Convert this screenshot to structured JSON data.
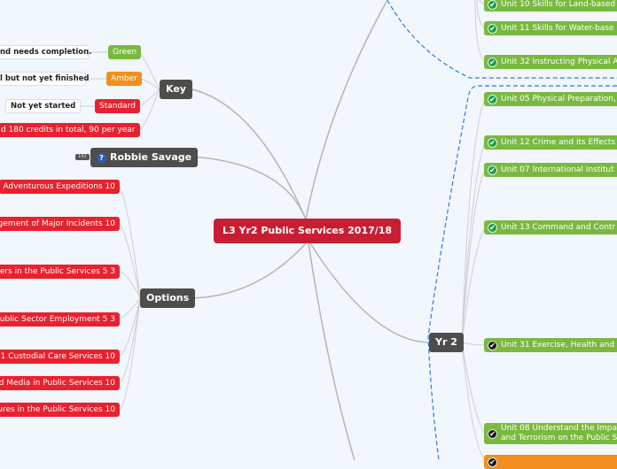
{
  "root": {
    "title": "L3 Yr2 Public Services 2017/18"
  },
  "colors": {
    "root": "#c81e33",
    "red": "#e9212e",
    "green": "#7ab93f",
    "amber": "#f28f1e",
    "dark": "#4d4d4b",
    "boundary": "#2d7fd9"
  },
  "key": {
    "title": "Key",
    "items": [
      {
        "label": "Green",
        "note": "nd needs completion."
      },
      {
        "label": "Amber",
        "note": "l but not yet finished"
      },
      {
        "label": "Standard",
        "note": "Not yet started"
      },
      {
        "label": "d 180 credits in total, 90 per year"
      }
    ]
  },
  "person": {
    "name": "Robbie Savage",
    "badge": "142",
    "icon": "question-icon"
  },
  "options": {
    "title": "Options",
    "items": [
      "Adventurous Expeditions 10",
      "gement of Major Incidents 10",
      "ers in the Public Services 5 3",
      "ublic Sector Employment 5 3",
      "1 Custodial Care Services 10",
      "d Media in Public Services 10",
      "ures in the Public Services 10"
    ]
  },
  "yr1_units": [
    {
      "label": "Unit 10 Skills for Land-based",
      "status": "check-green"
    },
    {
      "label": "Unit 11 Skills for Water-base",
      "status": "check-green"
    },
    {
      "label": "Unit 32 Instructing Physical A",
      "status": "check-green"
    }
  ],
  "yr2": {
    "title": "Yr 2",
    "units": [
      {
        "label": "Unit 05 Physical Preparation,",
        "status": "check-green"
      },
      {
        "label": "Unit 12 Crime and its Effects",
        "status": "check-green"
      },
      {
        "label": "Unit 07 International Institut",
        "status": "check-green"
      },
      {
        "label": "Unit 13 Command and Contr",
        "status": "check-green"
      },
      {
        "label": "Unit 31 Exercise, Health and",
        "status": "check-black"
      },
      {
        "label": "Unit 08 Understand the Impa",
        "label2": "and Terrorism on the Public S",
        "status": "check-black"
      },
      {
        "label": "",
        "status": "check-black"
      }
    ]
  }
}
